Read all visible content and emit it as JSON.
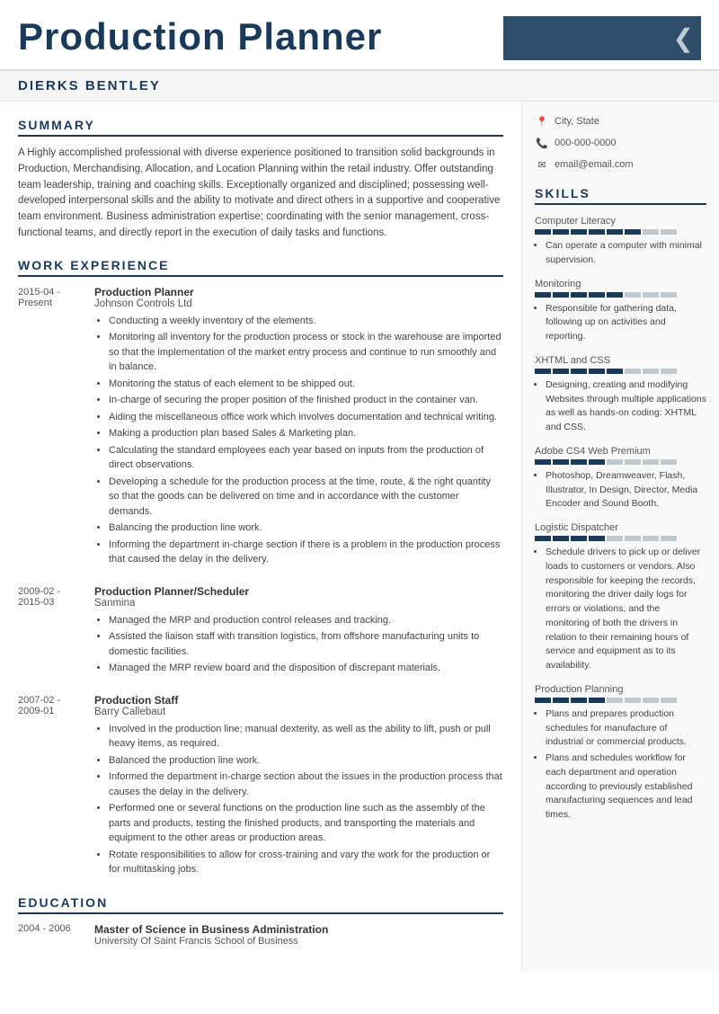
{
  "header": {
    "title": "Production Planner"
  },
  "name": "DIERKS BENTLEY",
  "contact": {
    "location": "City, State",
    "phone": "000-000-0000",
    "email": "email@email.com"
  },
  "summary": {
    "heading": "SUMMARY",
    "text": "A Highly accomplished professional with diverse experience positioned to transition solid backgrounds in Production, Merchandising, Allocation, and Location Planning within the retail industry. Offer outstanding team leadership, training and coaching skills. Exceptionally organized and disciplined; possessing well-developed interpersonal skills and the ability to motivate and direct others in a supportive and cooperative team environment. Business administration expertise; coordinating with the senior management, cross-functional teams, and directly report in the execution of daily tasks and functions."
  },
  "work_experience": {
    "heading": "WORK EXPERIENCE",
    "jobs": [
      {
        "date_start": "2015-04 -",
        "date_end": "Present",
        "title": "Production Planner",
        "company": "Johnson Controls Ltd",
        "bullets": [
          "Conducting a weekly inventory of the elements.",
          "Monitoring all inventory for the production process or stock in the warehouse are imported so that the implementation of the market entry process and continue to run smoothly and in balance.",
          "Monitoring the status of each element to be shipped out.",
          "In-charge of securing the proper position of the finished product in the container van.",
          "Aiding the miscellaneous office work which involves documentation and technical writing.",
          "Making a production plan based Sales & Marketing plan.",
          "Calculating the standard employees each year based on inputs from the production of direct observations.",
          "Developing a schedule for the production process at the time, route, & the right quantity so that the goods can be delivered on time and in accordance with the customer demands.",
          "Balancing the production line work.",
          "Informing the department in-charge section if there is a problem in the production process that caused the delay in the delivery."
        ]
      },
      {
        "date_start": "2009-02 -",
        "date_end": "2015-03",
        "title": "Production Planner/Scheduler",
        "company": "Sanmina",
        "bullets": [
          "Managed the MRP and production control releases and tracking.",
          "Assisted the liaison staff with transition logistics, from offshore manufacturing units to domestic facilities.",
          "Managed the MRP review board and the disposition of discrepant materials."
        ]
      },
      {
        "date_start": "2007-02 -",
        "date_end": "2009-01",
        "title": "Production Staff",
        "company": "Barry Callebaut",
        "bullets": [
          "Involved in the production line; manual dexterity, as well as the ability to lift, push or pull heavy items, as required.",
          "Balanced the production line work.",
          "Informed the department in-charge section about the issues in the production process that causes the delay in the delivery.",
          "Performed one or several functions on the production line such as the assembly of the parts and products, testing the finished products, and transporting the materials and equipment to the other areas or production areas.",
          "Rotate responsibilities to allow for cross-training and vary the work for the production or for multitasking jobs."
        ]
      }
    ]
  },
  "education": {
    "heading": "EDUCATION",
    "items": [
      {
        "date_start": "2004 - 2006",
        "degree": "Master of Science in Business Administration",
        "school": "University Of Saint Francis School of Business"
      }
    ]
  },
  "skills": {
    "heading": "SKILLS",
    "items": [
      {
        "name": "Computer Literacy",
        "filled": 6,
        "total": 8,
        "bullets": [
          "Can operate a computer with minimal supervision."
        ]
      },
      {
        "name": "Monitoring",
        "filled": 5,
        "total": 8,
        "bullets": [
          "Responsible for gathering data, following up on activities and reporting."
        ]
      },
      {
        "name": "XHTML and CSS",
        "filled": 5,
        "total": 8,
        "bullets": [
          "Designing, creating and modifying Websites through multiple applications as well as hands-on coding: XHTML and CSS."
        ]
      },
      {
        "name": "Adobe CS4 Web Premium",
        "filled": 4,
        "total": 8,
        "bullets": [
          "Photoshop, Dreamweaver, Flash, Illustrator, In Design, Director, Media Encoder and Sound Booth."
        ]
      },
      {
        "name": "Logistic Dispatcher",
        "filled": 4,
        "total": 8,
        "bullets": [
          "Schedule drivers to pick up or deliver loads to customers or vendors. Also responsible for keeping the records, monitoring the driver daily logs for errors or violations, and the monitoring of both the drivers in relation to their remaining hours of service and equipment as to its availability."
        ]
      },
      {
        "name": "Production Planning",
        "filled": 4,
        "total": 8,
        "bullets": [
          "Plans and prepares production schedules for manufacture of industrial or commercial products.",
          "Plans and schedules workflow for each department and operation according to previously established manufacturing sequences and lead times."
        ]
      }
    ]
  }
}
